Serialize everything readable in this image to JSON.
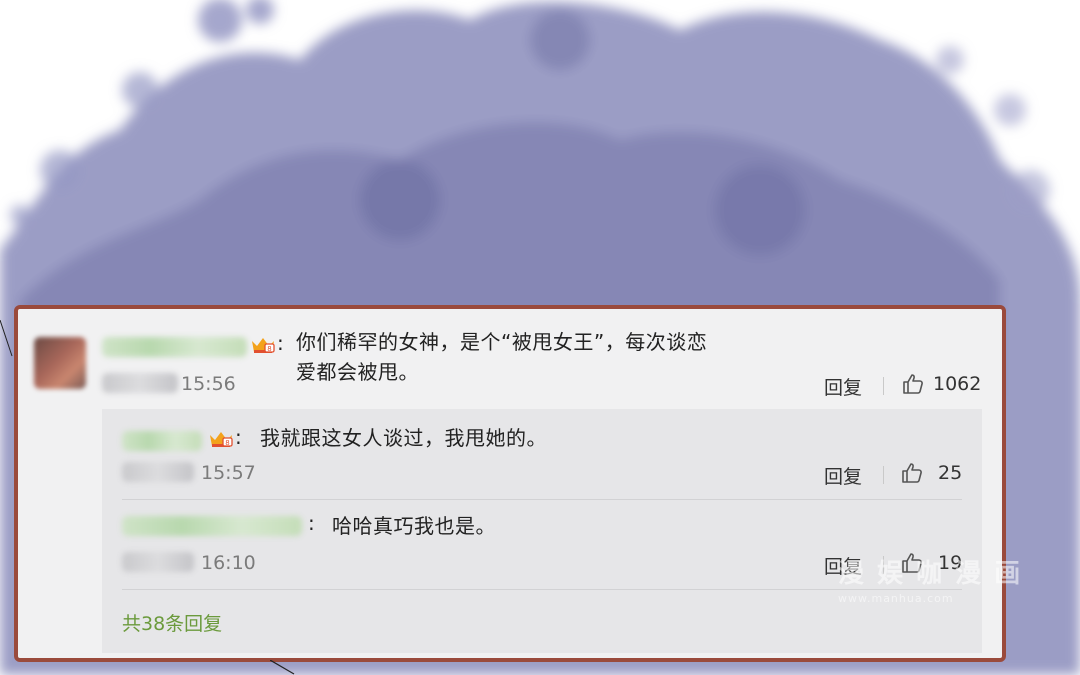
{
  "colors": {
    "card_border": "#9a4a3c",
    "card_bg": "#f1f1f2",
    "reply_bg": "#e6e6e8",
    "more_link": "#6b9a3c",
    "watercolor": "#7f82b3"
  },
  "comment": {
    "username": "",
    "badge_icon": "vip-crown-icon",
    "colon": ":",
    "text_line1": "你们稀罕的女神，是个“被甩女王”，每次谈恋",
    "text_line2": "爱都会被甩。",
    "time": "15:56",
    "reply_label": "回复",
    "like_icon": "thumbs-up-icon",
    "likes": "1062"
  },
  "replies": [
    {
      "badge_icon": "vip-crown-icon",
      "colon": ":",
      "text": "我就跟这女人谈过，我甩她的。",
      "time": "15:57",
      "reply_label": "回复",
      "likes": "25"
    },
    {
      "colon": ":",
      "text": "哈哈真巧我也是。",
      "time": "16:10",
      "reply_label": "回复",
      "likes": "19"
    }
  ],
  "more_replies": "共38条回复"
}
